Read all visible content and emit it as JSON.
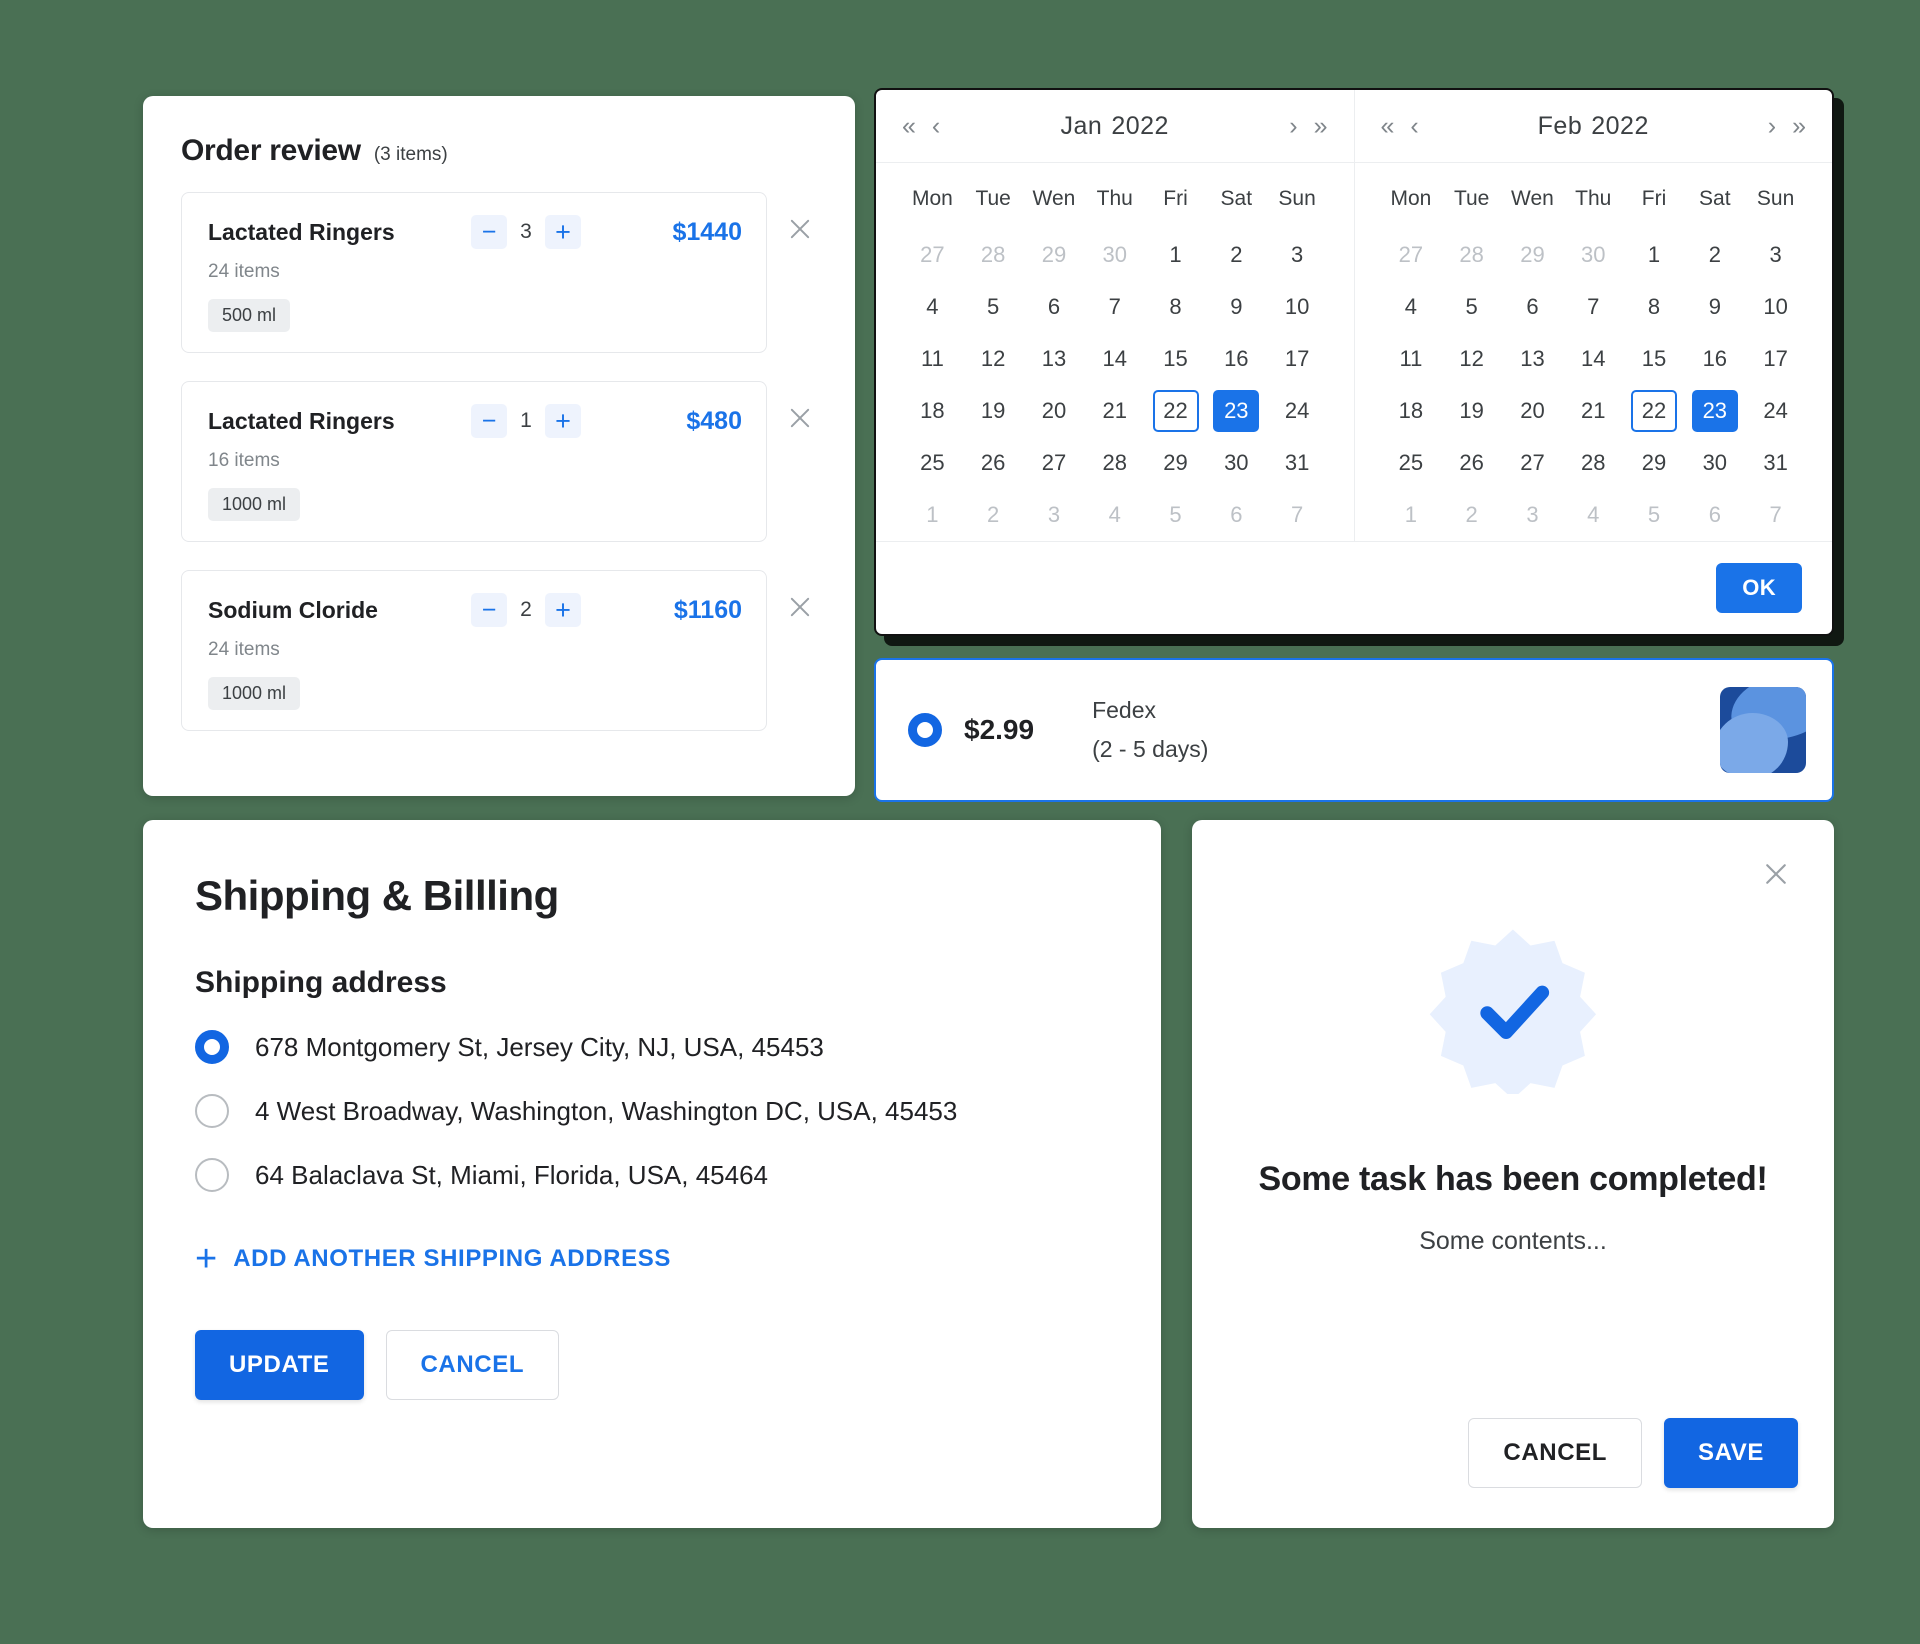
{
  "order_review": {
    "title": "Order review",
    "count_label": "(3 items)",
    "close_icon": "close-icon",
    "minus_icon": "minus-icon",
    "plus_icon": "plus-icon",
    "items": [
      {
        "name": "Lactated Ringers",
        "qty": "3",
        "price": "$1440",
        "sub": "24 items",
        "tag": "500 ml"
      },
      {
        "name": "Lactated Ringers",
        "qty": "1",
        "price": "$480",
        "sub": "16 items",
        "tag": "1000 ml"
      },
      {
        "name": "Sodium Cloride",
        "qty": "2",
        "price": "$1160",
        "sub": "24 items",
        "tag": "1000 ml"
      }
    ]
  },
  "calendar": {
    "nav": {
      "prev_year": "«",
      "prev_month": "‹",
      "next_month": "›",
      "next_year": "»"
    },
    "weekdays": [
      "Mon",
      "Tue",
      "Wen",
      "Thu",
      "Fri",
      "Sat",
      "Sun"
    ],
    "ok_label": "OK",
    "months": [
      {
        "month": "Jan",
        "year": "2022",
        "weeks": [
          [
            {
              "d": "27",
              "s": "muted"
            },
            {
              "d": "28",
              "s": "muted"
            },
            {
              "d": "29",
              "s": "muted"
            },
            {
              "d": "30",
              "s": "muted"
            },
            {
              "d": "1",
              "s": ""
            },
            {
              "d": "2",
              "s": ""
            },
            {
              "d": "3",
              "s": ""
            }
          ],
          [
            {
              "d": "4",
              "s": ""
            },
            {
              "d": "5",
              "s": ""
            },
            {
              "d": "6",
              "s": ""
            },
            {
              "d": "7",
              "s": ""
            },
            {
              "d": "8",
              "s": ""
            },
            {
              "d": "9",
              "s": ""
            },
            {
              "d": "10",
              "s": ""
            }
          ],
          [
            {
              "d": "11",
              "s": ""
            },
            {
              "d": "12",
              "s": ""
            },
            {
              "d": "13",
              "s": ""
            },
            {
              "d": "14",
              "s": ""
            },
            {
              "d": "15",
              "s": ""
            },
            {
              "d": "16",
              "s": ""
            },
            {
              "d": "17",
              "s": ""
            }
          ],
          [
            {
              "d": "18",
              "s": ""
            },
            {
              "d": "19",
              "s": ""
            },
            {
              "d": "20",
              "s": ""
            },
            {
              "d": "21",
              "s": ""
            },
            {
              "d": "22",
              "s": "range-start"
            },
            {
              "d": "23",
              "s": "selected"
            },
            {
              "d": "24",
              "s": ""
            }
          ],
          [
            {
              "d": "25",
              "s": ""
            },
            {
              "d": "26",
              "s": ""
            },
            {
              "d": "27",
              "s": ""
            },
            {
              "d": "28",
              "s": ""
            },
            {
              "d": "29",
              "s": ""
            },
            {
              "d": "30",
              "s": ""
            },
            {
              "d": "31",
              "s": ""
            }
          ],
          [
            {
              "d": "1",
              "s": "muted"
            },
            {
              "d": "2",
              "s": "muted"
            },
            {
              "d": "3",
              "s": "muted"
            },
            {
              "d": "4",
              "s": "muted"
            },
            {
              "d": "5",
              "s": "muted"
            },
            {
              "d": "6",
              "s": "muted"
            },
            {
              "d": "7",
              "s": "muted"
            }
          ]
        ]
      },
      {
        "month": "Feb",
        "year": "2022",
        "weeks": [
          [
            {
              "d": "27",
              "s": "muted"
            },
            {
              "d": "28",
              "s": "muted"
            },
            {
              "d": "29",
              "s": "muted"
            },
            {
              "d": "30",
              "s": "muted"
            },
            {
              "d": "1",
              "s": ""
            },
            {
              "d": "2",
              "s": ""
            },
            {
              "d": "3",
              "s": ""
            }
          ],
          [
            {
              "d": "4",
              "s": ""
            },
            {
              "d": "5",
              "s": ""
            },
            {
              "d": "6",
              "s": ""
            },
            {
              "d": "7",
              "s": ""
            },
            {
              "d": "8",
              "s": ""
            },
            {
              "d": "9",
              "s": ""
            },
            {
              "d": "10",
              "s": ""
            }
          ],
          [
            {
              "d": "11",
              "s": ""
            },
            {
              "d": "12",
              "s": ""
            },
            {
              "d": "13",
              "s": ""
            },
            {
              "d": "14",
              "s": ""
            },
            {
              "d": "15",
              "s": ""
            },
            {
              "d": "16",
              "s": ""
            },
            {
              "d": "17",
              "s": ""
            }
          ],
          [
            {
              "d": "18",
              "s": ""
            },
            {
              "d": "19",
              "s": ""
            },
            {
              "d": "20",
              "s": ""
            },
            {
              "d": "21",
              "s": ""
            },
            {
              "d": "22",
              "s": "range-start"
            },
            {
              "d": "23",
              "s": "selected"
            },
            {
              "d": "24",
              "s": ""
            }
          ],
          [
            {
              "d": "25",
              "s": ""
            },
            {
              "d": "26",
              "s": ""
            },
            {
              "d": "27",
              "s": ""
            },
            {
              "d": "28",
              "s": ""
            },
            {
              "d": "29",
              "s": ""
            },
            {
              "d": "30",
              "s": ""
            },
            {
              "d": "31",
              "s": ""
            }
          ],
          [
            {
              "d": "1",
              "s": "muted"
            },
            {
              "d": "2",
              "s": "muted"
            },
            {
              "d": "3",
              "s": "muted"
            },
            {
              "d": "4",
              "s": "muted"
            },
            {
              "d": "5",
              "s": "muted"
            },
            {
              "d": "6",
              "s": "muted"
            },
            {
              "d": "7",
              "s": "muted"
            }
          ]
        ]
      }
    ]
  },
  "shipping_option": {
    "price": "$2.99",
    "carrier": "Fedex",
    "eta": "(2 - 5 days)",
    "selected": true,
    "logo_icon": "carrier-logo-icon"
  },
  "shipping_billing": {
    "title": "Shipping & Billling",
    "subtitle": "Shipping address",
    "addresses": [
      {
        "text": "678 Montgomery St, Jersey City, NJ, USA, 45453",
        "selected": true
      },
      {
        "text": "4 West Broadway, Washington, Washington DC, USA, 45453",
        "selected": false
      },
      {
        "text": "64 Balaclava St, Miami, Florida,  USA,  45464",
        "selected": false
      }
    ],
    "add_address_label": "ADD ANOTHER SHIPPING ADDRESS",
    "add_icon": "plus-icon",
    "update_label": "UPDATE",
    "cancel_label": "CANCEL"
  },
  "success_dialog": {
    "close_icon": "close-icon",
    "badge_icon": "check-badge-icon",
    "heading": "Some task has been completed!",
    "body": "Some contents...",
    "cancel_label": "CANCEL",
    "save_label": "SAVE"
  },
  "colors": {
    "accent": "#1a73e8",
    "accent_deep": "#1266e2",
    "background": "#4a7054",
    "badge_bg": "#e8f0fe"
  }
}
